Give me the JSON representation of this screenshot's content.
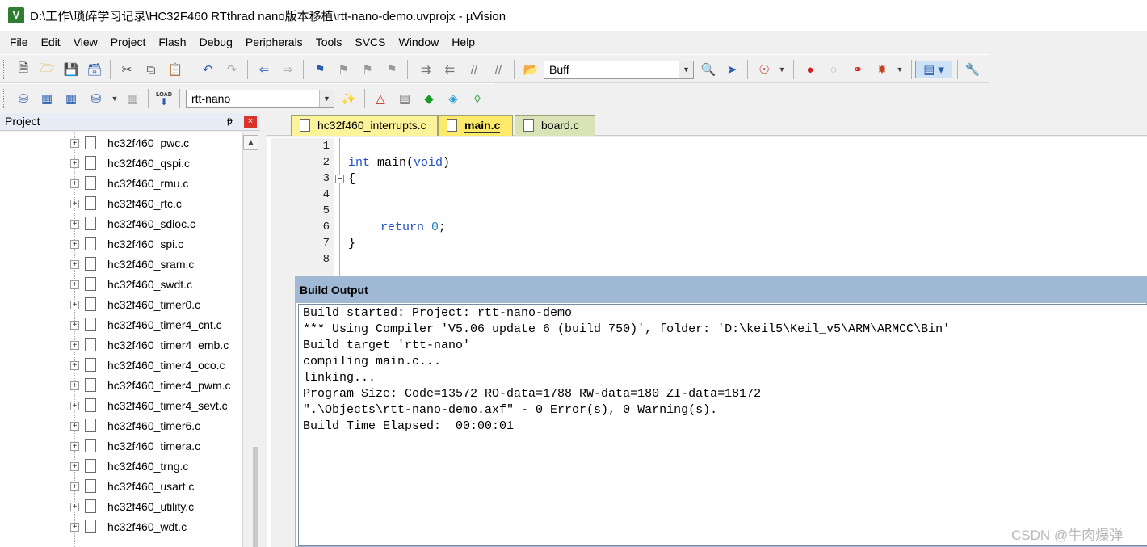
{
  "window": {
    "title": "D:\\工作\\琐碎学习记录\\HC32F460 RTthrad nano版本移植\\rtt-nano-demo.uvprojx - µVision",
    "icon_letter": "V"
  },
  "menu": [
    "File",
    "Edit",
    "View",
    "Project",
    "Flash",
    "Debug",
    "Peripherals",
    "Tools",
    "SVCS",
    "Window",
    "Help"
  ],
  "toolbar1": {
    "find_combo": "Buff"
  },
  "toolbar2": {
    "target_combo": "rtt-nano",
    "load_label": "LOAD"
  },
  "project": {
    "title": "Project",
    "pin": "ᵽ",
    "close": "×",
    "files": [
      "hc32f460_pwc.c",
      "hc32f460_qspi.c",
      "hc32f460_rmu.c",
      "hc32f460_rtc.c",
      "hc32f460_sdioc.c",
      "hc32f460_spi.c",
      "hc32f460_sram.c",
      "hc32f460_swdt.c",
      "hc32f460_timer0.c",
      "hc32f460_timer4_cnt.c",
      "hc32f460_timer4_emb.c",
      "hc32f460_timer4_oco.c",
      "hc32f460_timer4_pwm.c",
      "hc32f460_timer4_sevt.c",
      "hc32f460_timer6.c",
      "hc32f460_timera.c",
      "hc32f460_trng.c",
      "hc32f460_usart.c",
      "hc32f460_utility.c",
      "hc32f460_wdt.c"
    ]
  },
  "tabs": [
    "hc32f460_interrupts.c",
    "main.c",
    "board.c"
  ],
  "editor": {
    "line_numbers": [
      "1",
      "2",
      "3",
      "4",
      "5",
      "6",
      "7",
      "8"
    ],
    "line2_kw": "int",
    "line2_mid": " main(",
    "line2_kw2": "void",
    "line2_end": ")",
    "line3": "{",
    "line6_kw": "return",
    "line6_num": "0",
    "line6_end": ";",
    "line7": "}"
  },
  "build_output": {
    "title": "Build Output",
    "lines": [
      "Build started: Project: rtt-nano-demo",
      "*** Using Compiler 'V5.06 update 6 (build 750)', folder: 'D:\\keil5\\Keil_v5\\ARM\\ARMCC\\Bin'",
      "Build target 'rtt-nano'",
      "compiling main.c...",
      "linking...",
      "Program Size: Code=13572 RO-data=1788 RW-data=180 ZI-data=18172",
      "\".\\Objects\\rtt-nano-demo.axf\" - 0 Error(s), 0 Warning(s).",
      "Build Time Elapsed:  00:00:01"
    ]
  },
  "watermark": "CSDN @牛肉爆弹"
}
